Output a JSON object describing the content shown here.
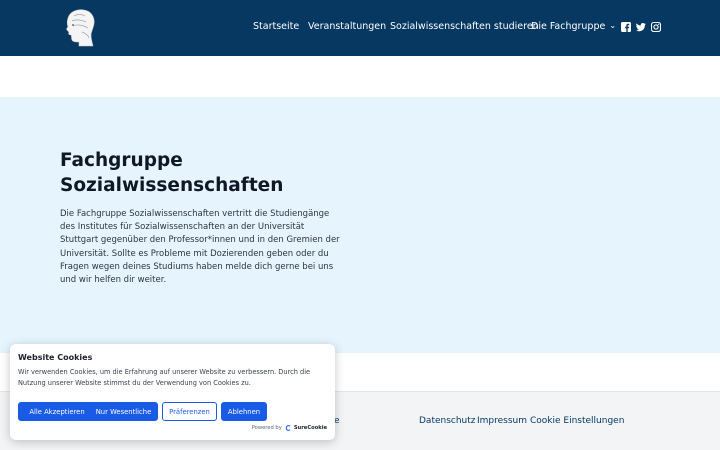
{
  "header": {
    "nav": [
      {
        "label": "Startseite"
      },
      {
        "label": "Veranstaltungen"
      },
      {
        "label": "Sozialwissenschaften studieren"
      },
      {
        "label": "Die Fachgruppe",
        "has_dropdown": true
      }
    ],
    "social_icons": [
      "facebook-icon",
      "twitter-icon",
      "instagram-icon"
    ]
  },
  "hero": {
    "title": "Fachgruppe Sozialwissenschaften",
    "text": "Die Fachgruppe Sozialwissenschaften vertritt die Studiengänge des Institutes für Sozialwissenschaften an der Universität Stuttgart gegenüber den Professor*innen und in den Gremien der Universität. Sollte es Probleme mit Dozierenden geben oder du Fragen wegen deines Studiums haben melde dich gerne bei uns und wir helfen dir weiter."
  },
  "footer": {
    "partial_text": "e",
    "links": [
      "Datenschutz",
      "Impressum",
      "Cookie Einstellungen"
    ]
  },
  "cookie_banner": {
    "title": "Website Cookies",
    "text": "Wir verwenden Cookies, um die Erfahrung auf unserer Website zu verbessern. Durch die Nutzung unserer Website stimmst du der Verwendung von Cookies zu.",
    "buttons": {
      "accept_all": "Alle Akzeptieren",
      "essential_only": "Nur Wesentliche",
      "preferences": "Präferenzen",
      "decline": "Ablehnen"
    },
    "powered_by": "Powered by",
    "brand": "SureCookie"
  },
  "colors": {
    "header_bg": "#063862",
    "hero_bg": "#e6f4fd",
    "button_primary": "#1a5be6"
  }
}
